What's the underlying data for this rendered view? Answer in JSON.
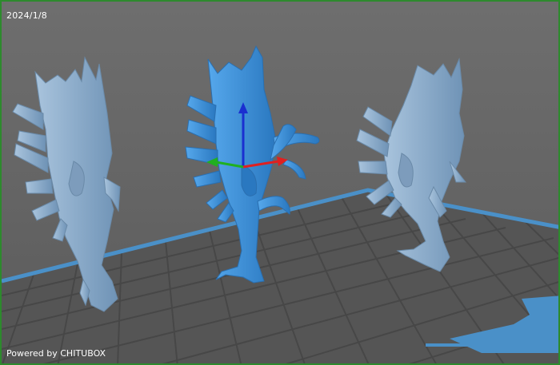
{
  "viewport": {
    "date_stamp": "2024/1/8",
    "footer_text": "Powered by CHITUBOX"
  },
  "scene": {
    "models": [
      {
        "name": "left-model",
        "selected": false
      },
      {
        "name": "center-model",
        "selected": true
      },
      {
        "name": "right-model",
        "selected": false
      }
    ],
    "gizmo": {
      "axes": [
        "x",
        "y",
        "z"
      ]
    }
  },
  "colors": {
    "background": "#646464",
    "plate_grid": "#4f4f4f",
    "plate_border": "#4a90c8",
    "model": "#8fb3d3",
    "model_selected": "#3c8fd6",
    "axis_x": "#e02020",
    "axis_y": "#20b020",
    "axis_z": "#1a2fd0",
    "frame": "#2d8a2d"
  }
}
